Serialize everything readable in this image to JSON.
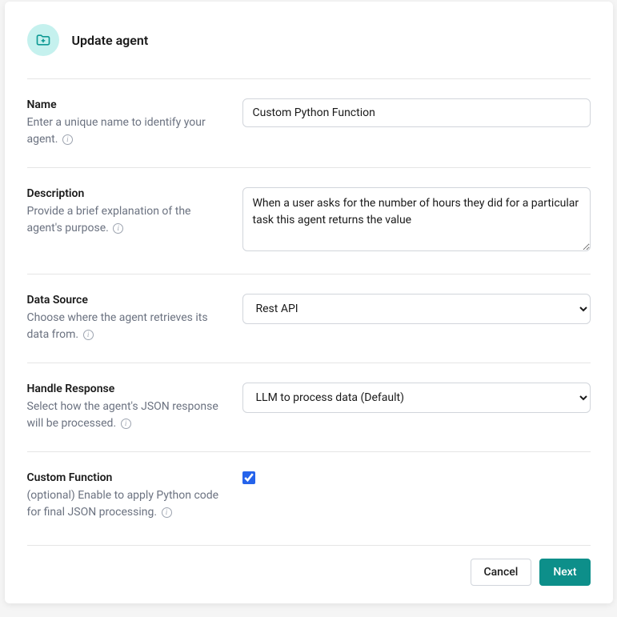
{
  "header": {
    "title": "Update agent"
  },
  "fields": {
    "name": {
      "label": "Name",
      "help": "Enter a unique name to identify your agent.",
      "value": "Custom Python Function"
    },
    "description": {
      "label": "Description",
      "help": "Provide a brief explanation of the agent's purpose.",
      "value": "When a user asks for the number of hours they did for a particular task this agent returns the value"
    },
    "dataSource": {
      "label": "Data Source",
      "help": "Choose where the agent retrieves its data from.",
      "selected": "Rest API"
    },
    "handleResponse": {
      "label": "Handle Response",
      "help": "Select how the agent's JSON response will be processed.",
      "selected": "LLM to process data (Default)"
    },
    "customFunction": {
      "label": "Custom Function",
      "help": "(optional) Enable to apply Python code for final JSON processing.",
      "checked": true
    }
  },
  "footer": {
    "cancel": "Cancel",
    "next": "Next"
  }
}
